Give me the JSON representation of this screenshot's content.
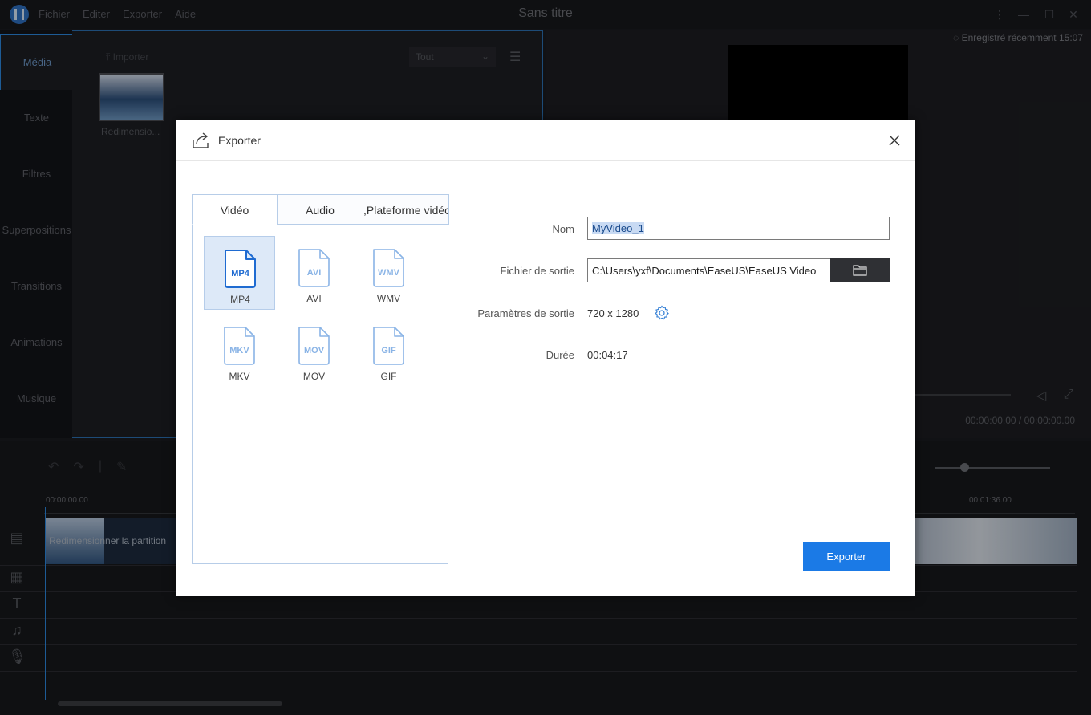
{
  "app": {
    "window_title": "Sans titre",
    "menu": [
      "Fichier",
      "Editer",
      "Exporter",
      "Aide"
    ]
  },
  "side_tabs": [
    "Média",
    "Texte",
    "Filtres",
    "Superpositions",
    "Transitions",
    "Animations",
    "Musique"
  ],
  "media": {
    "import_label": "Importer",
    "filter_value": "Tout",
    "item_name": "Redimensio..."
  },
  "preview": {
    "saved_status": "Enregistré récemment 15:07",
    "time": "00:00:00.00 / 00:00:00.00"
  },
  "timeline": {
    "timecode_start": "00:00:00.00",
    "timecode_mid": "00:01:36.00",
    "clip_label": "Redimensionner la partition"
  },
  "dialog": {
    "title": "Exporter",
    "tabs": [
      "Vidéo",
      "Audio",
      "Plateforme vidéo"
    ],
    "formats": [
      "MP4",
      "AVI",
      "WMV",
      "MKV",
      "MOV",
      "GIF"
    ],
    "selected_format": "MP4",
    "fields": {
      "name_label": "Nom",
      "name_value": "MyVideo_1",
      "output_label": "Fichier de sortie",
      "output_value": "C:\\Users\\yxf\\Documents\\EaseUS\\EaseUS Video",
      "params_label": "Paramètres de sortie",
      "params_value": "720 x 1280",
      "duration_label": "Durée",
      "duration_value": "00:04:17"
    },
    "export_button": "Exporter"
  },
  "colors": {
    "accent": "#1b7ae6",
    "selected_bg": "#dde9f8",
    "icon_blue": "#1f6bd1",
    "icon_light": "#8ab4e6"
  }
}
